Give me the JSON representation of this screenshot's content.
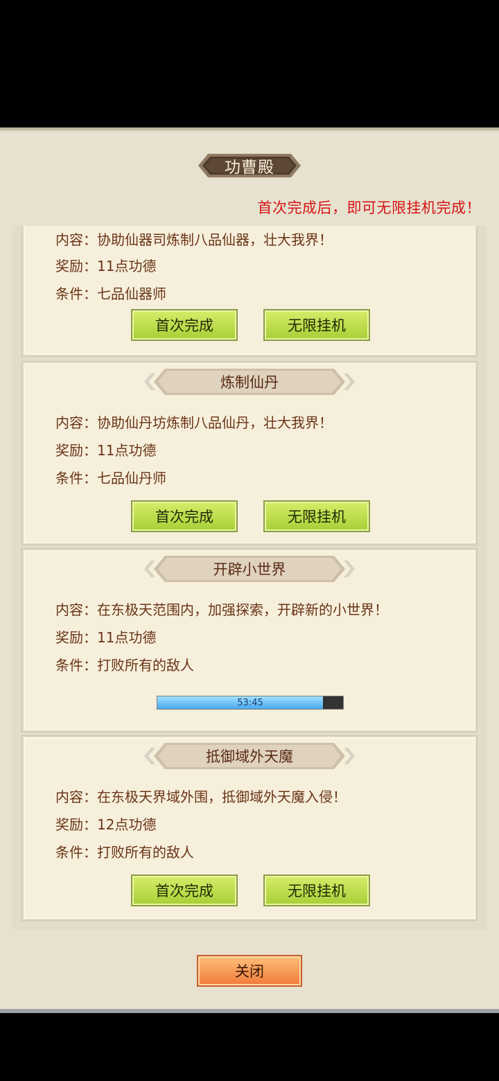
{
  "dialog": {
    "title": "功曹殿",
    "notice": "首次完成后，即可无限挂机完成！",
    "close_label": "关闭"
  },
  "cards": [
    {
      "title": "",
      "content": "内容：协助仙器司炼制八品仙器，壮大我界！",
      "reward": "奖励：11点功德",
      "condition": "条件：七品仙器师",
      "first_complete_label": "首次完成",
      "idle_label": "无限挂机"
    },
    {
      "title": "炼制仙丹",
      "content": "内容：协助仙丹坊炼制八品仙丹，壮大我界！",
      "reward": "奖励：11点功德",
      "condition": "条件：七品仙丹师",
      "first_complete_label": "首次完成",
      "idle_label": "无限挂机"
    },
    {
      "title": "开辟小世界",
      "content": "内容：在东极天范围内，加强探索，开辟新的小世界！",
      "reward": "奖励：11点功德",
      "condition": "条件：打败所有的敌人",
      "timer": "53:45",
      "progress": 0.89
    },
    {
      "title": "抵御域外天魔",
      "content": "内容：在东极天界域外围，抵御域外天魔入侵！",
      "reward": "奖励：12点功德",
      "condition": "条件：打败所有的敌人",
      "first_complete_label": "首次完成",
      "idle_label": "无限挂机"
    }
  ]
}
